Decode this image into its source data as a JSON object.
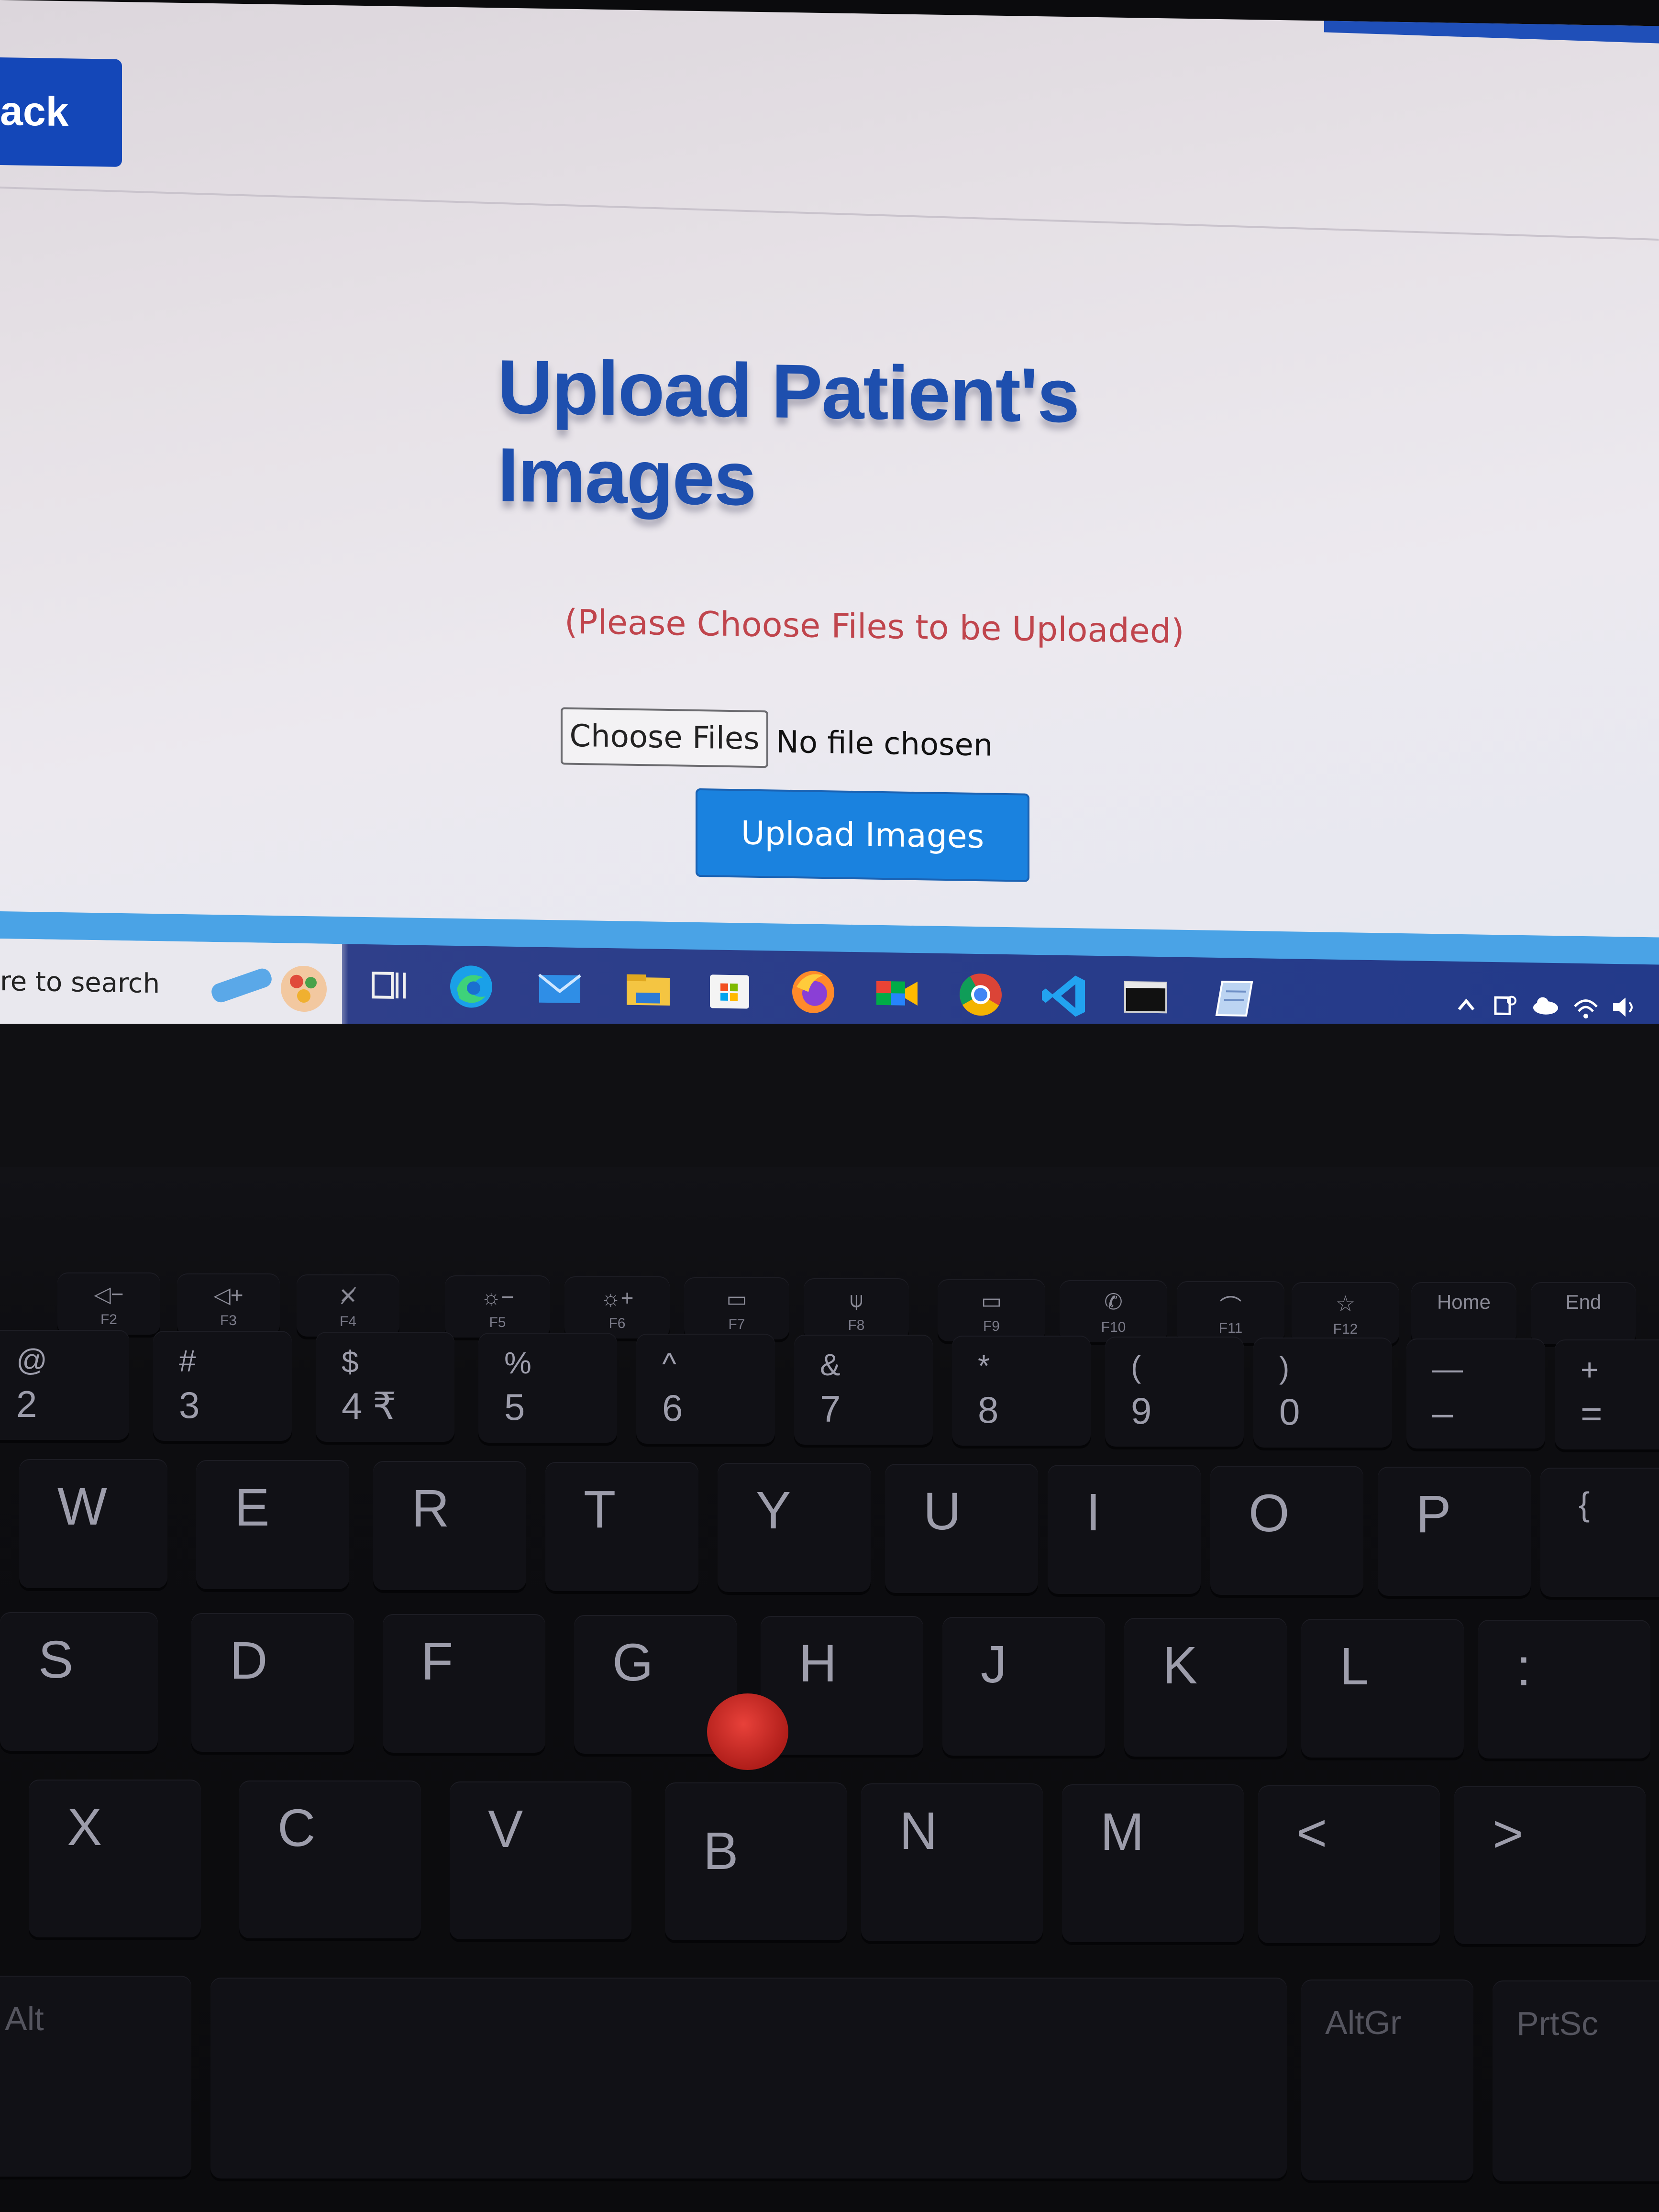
{
  "page": {
    "back_label": "ack",
    "title": "Upload Patient's Images",
    "instruction": "(Please Choose Files to be Uploaded)",
    "choose_files_label": "Choose Files",
    "file_status": "No file chosen",
    "upload_label": "Upload Images"
  },
  "taskbar": {
    "search_text": "re to search",
    "icons": [
      "task-view-icon",
      "edge-icon",
      "mail-icon",
      "file-explorer-icon",
      "store-icon",
      "firefox-icon",
      "meet-icon",
      "chrome-icon",
      "vscode-icon",
      "terminal-icon",
      "notepad-icon"
    ],
    "tray": [
      "chevron-up-icon",
      "meet-now-icon",
      "onedrive-icon",
      "wifi-icon",
      "volume-icon"
    ]
  },
  "keyboard": {
    "fn_keys": [
      {
        "label": "F2",
        "sym": "◁−"
      },
      {
        "label": "F3",
        "sym": "◁+"
      },
      {
        "label": "F4",
        "sym": "✕̸"
      },
      {
        "label": "F5",
        "sym": "☼−"
      },
      {
        "label": "F6",
        "sym": "☼+"
      },
      {
        "label": "F7",
        "sym": "▭"
      },
      {
        "label": "F8",
        "sym": "⍦"
      },
      {
        "label": "F9",
        "sym": "▭"
      },
      {
        "label": "F10",
        "sym": "✆"
      },
      {
        "label": "F11",
        "sym": "⌒"
      },
      {
        "label": "F12",
        "sym": "☆"
      },
      {
        "label": "",
        "sym": "Home"
      },
      {
        "label": "",
        "sym": "End"
      }
    ],
    "num_keys": [
      {
        "top": "@",
        "bottom": "2"
      },
      {
        "top": "#",
        "bottom": "3"
      },
      {
        "top": "$",
        "bottom": "4 ₹"
      },
      {
        "top": "%",
        "bottom": "5"
      },
      {
        "top": "^",
        "bottom": "6"
      },
      {
        "top": "&",
        "bottom": "7"
      },
      {
        "top": "*",
        "bottom": "8"
      },
      {
        "top": "(",
        "bottom": "9"
      },
      {
        "top": ")",
        "bottom": "0"
      },
      {
        "top": "—",
        "bottom": "–"
      },
      {
        "top": "+",
        "bottom": "="
      }
    ],
    "row_qwerty": [
      "W",
      "E",
      "R",
      "T",
      "Y",
      "U",
      "I",
      "O",
      "P",
      "{"
    ],
    "row_home": [
      "S",
      "D",
      "F",
      "G",
      "H",
      "J",
      "K",
      "L",
      ":"
    ],
    "row_bottom": [
      "X",
      "C",
      "V",
      "B",
      "N",
      "M",
      "<",
      ">"
    ],
    "mod_left": "Alt",
    "mod_altgr": "AltGr",
    "mod_prtsc": "PrtSc"
  },
  "colors": {
    "title": "#1e4fae",
    "instruction": "#c0454d",
    "primary_button": "#1a82df",
    "back_button": "#1447b8",
    "trackpoint": "#d8302b"
  }
}
